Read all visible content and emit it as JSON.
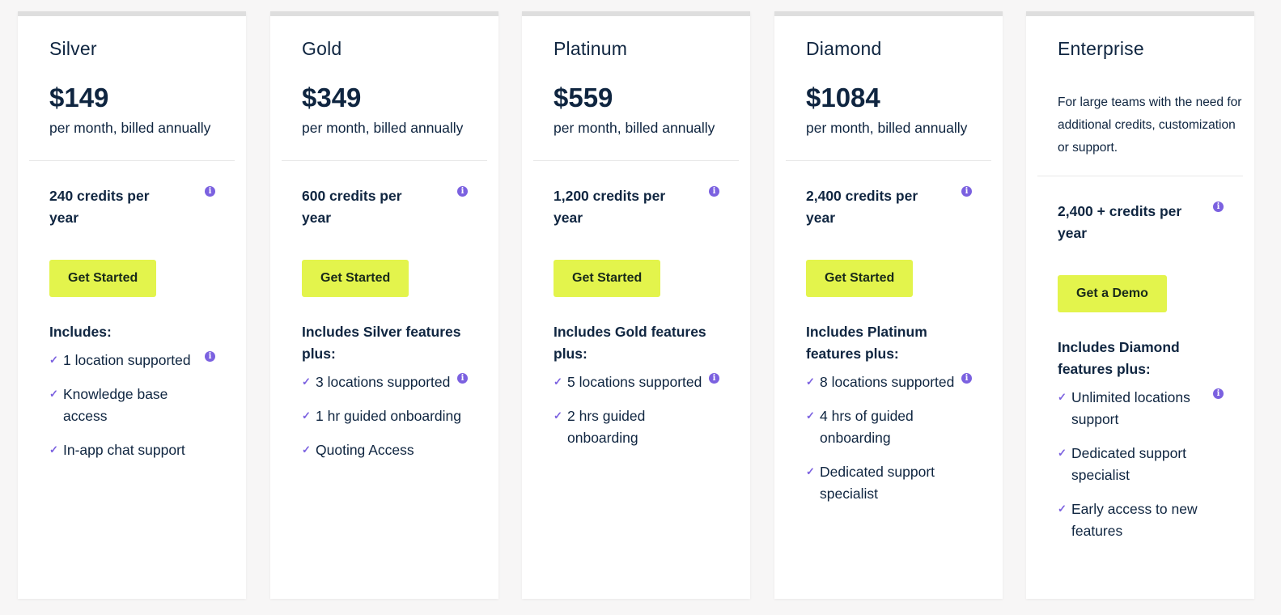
{
  "plans": [
    {
      "name": "Silver",
      "price": "$149",
      "billing": "per month, billed annually",
      "credits": "240 credits per year",
      "cta": "Get Started",
      "includes": "Includes:",
      "features": [
        "1 location supported",
        "Knowledge base access",
        "In-app chat support"
      ]
    },
    {
      "name": "Gold",
      "price": "$349",
      "billing": "per month, billed annually",
      "credits": "600 credits per year",
      "cta": "Get Started",
      "includes": "Includes Silver features plus:",
      "features": [
        "3 locations supported",
        "1 hr guided onboarding",
        "Quoting Access"
      ]
    },
    {
      "name": "Platinum",
      "price": "$559",
      "billing": "per month, billed annually",
      "credits": "1,200 credits per year",
      "cta": "Get Started",
      "includes": "Includes Gold features plus:",
      "features": [
        "5 locations supported",
        "2 hrs guided onboarding"
      ]
    },
    {
      "name": "Diamond",
      "price": "$1084",
      "billing": "per month, billed annually",
      "credits": "2,400 credits per year",
      "cta": "Get Started",
      "includes": "Includes Platinum features plus:",
      "features": [
        "8 locations supported",
        "4 hrs of guided onboarding",
        "Dedicated support specialist"
      ]
    },
    {
      "name": "Enterprise",
      "description": "For large teams with the need for additional credits, customization or support.",
      "credits": "2,400 + credits per year",
      "cta": "Get a Demo",
      "includes": "Includes Diamond features plus:",
      "features": [
        "Unlimited locations support",
        "Dedicated support specialist",
        "Early access to new features"
      ]
    }
  ],
  "icons": {
    "info": "info-icon",
    "check": "check-icon"
  },
  "colors": {
    "accent_button": "#e3f44c",
    "icon_purple": "#7b61e0",
    "text": "#0f2540"
  }
}
